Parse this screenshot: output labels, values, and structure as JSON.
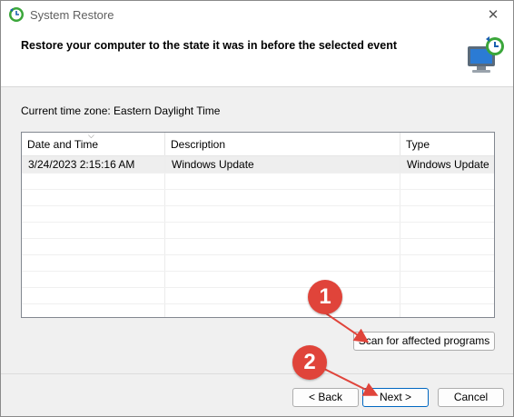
{
  "window": {
    "title": "System Restore",
    "close_glyph": "✕"
  },
  "header": {
    "title": "Restore your computer to the state it was in before the selected event",
    "icon": "system-restore-monitor-icon"
  },
  "timezone_label": "Current time zone: Eastern Daylight Time",
  "table": {
    "columns": [
      "Date and Time",
      "Description",
      "Type"
    ],
    "sort_indicator": "⌵",
    "rows": [
      {
        "date": "3/24/2023 2:15:16 AM",
        "description": "Windows Update",
        "type": "Windows Update",
        "selected": true
      }
    ]
  },
  "buttons": {
    "scan": "Scan for affected programs",
    "back": "< Back",
    "next": "Next >",
    "cancel": "Cancel"
  },
  "annotations": {
    "badge1": "1",
    "badge2": "2",
    "color": "#e0443a"
  },
  "colors": {
    "accent": "#0067c0",
    "selected_row": "#eeeeee"
  }
}
